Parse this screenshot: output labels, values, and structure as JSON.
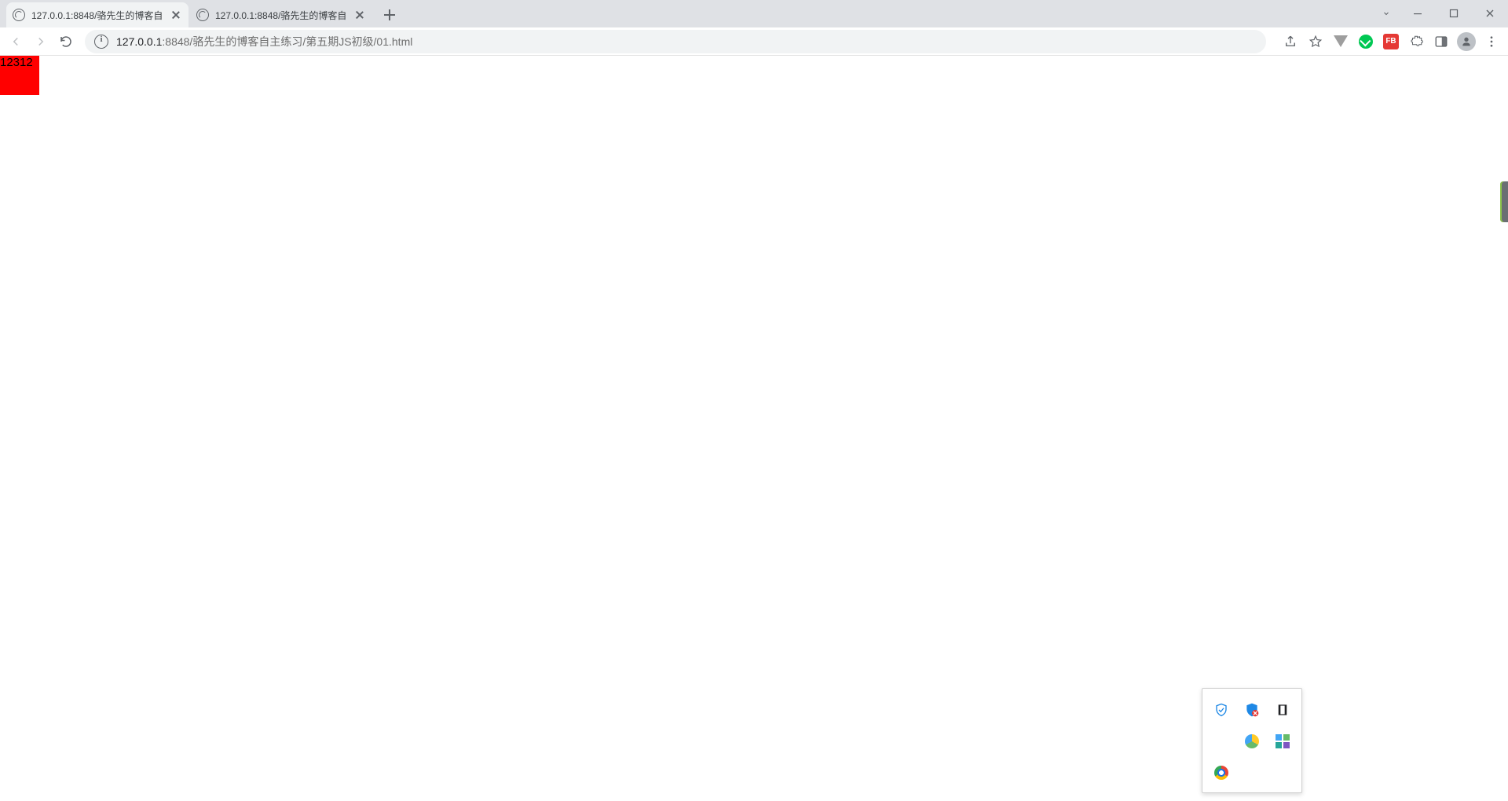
{
  "tabs": [
    {
      "title": "127.0.0.1:8848/骆先生的博客自",
      "active": true
    },
    {
      "title": "127.0.0.1:8848/骆先生的博客自",
      "active": false
    }
  ],
  "url": {
    "host": "127.0.0.1",
    "rest": ":8848/骆先生的博客自主练习/第五期JS初级/01.html"
  },
  "page": {
    "box_text": "12312"
  },
  "ext": {
    "fb_label": "FB"
  }
}
